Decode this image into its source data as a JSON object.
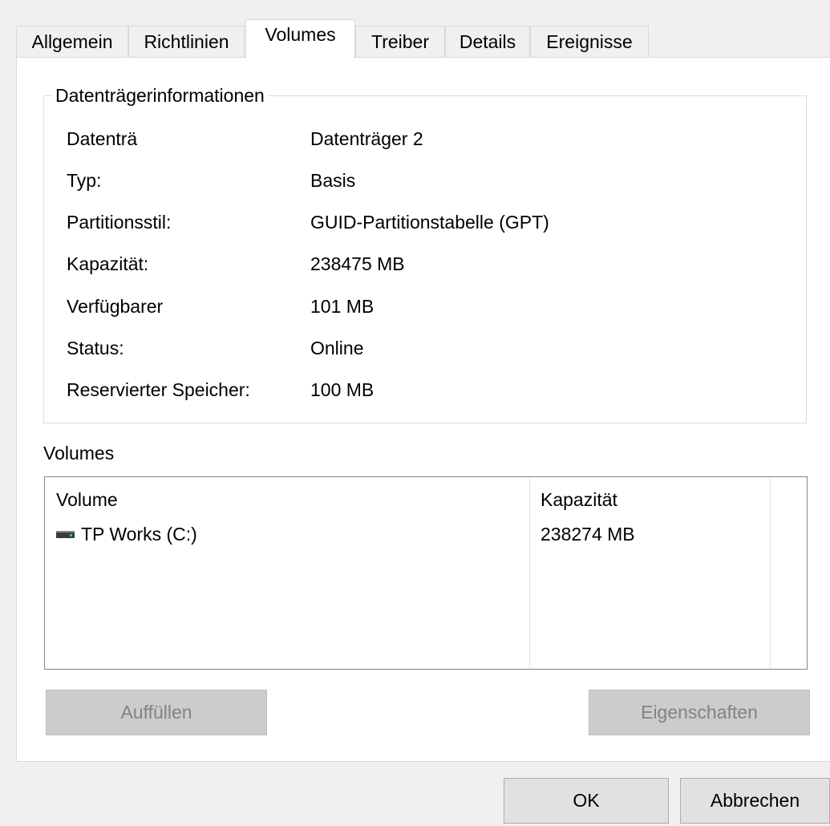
{
  "tabs": [
    {
      "label": "Allgemein"
    },
    {
      "label": "Richtlinien"
    },
    {
      "label": "Volumes"
    },
    {
      "label": "Treiber"
    },
    {
      "label": "Details"
    },
    {
      "label": "Ereignisse"
    }
  ],
  "active_tab": "Volumes",
  "disk_info": {
    "title": "Datenträgerinformationen",
    "rows": [
      {
        "label": "Datenträ",
        "value": "Datenträger 2"
      },
      {
        "label": "Typ:",
        "value": "Basis"
      },
      {
        "label": "Partitionsstil:",
        "value": "GUID-Partitionstabelle (GPT)"
      },
      {
        "label": "Kapazität:",
        "value": "238475 MB"
      },
      {
        "label": "Verfügbarer",
        "value": "101 MB"
      },
      {
        "label": "Status:",
        "value": "Online"
      },
      {
        "label": "Reservierter Speicher:",
        "value": "100 MB"
      }
    ]
  },
  "volumes": {
    "section_label": "Volumes",
    "columns": [
      "Volume",
      "Kapazität"
    ],
    "rows": [
      {
        "icon": "drive-icon",
        "name": "TP Works (C:)",
        "capacity": "238274 MB"
      }
    ]
  },
  "buttons": {
    "fill": "Auffüllen",
    "properties": "Eigenschaften",
    "ok": "OK",
    "cancel": "Abbrechen"
  }
}
